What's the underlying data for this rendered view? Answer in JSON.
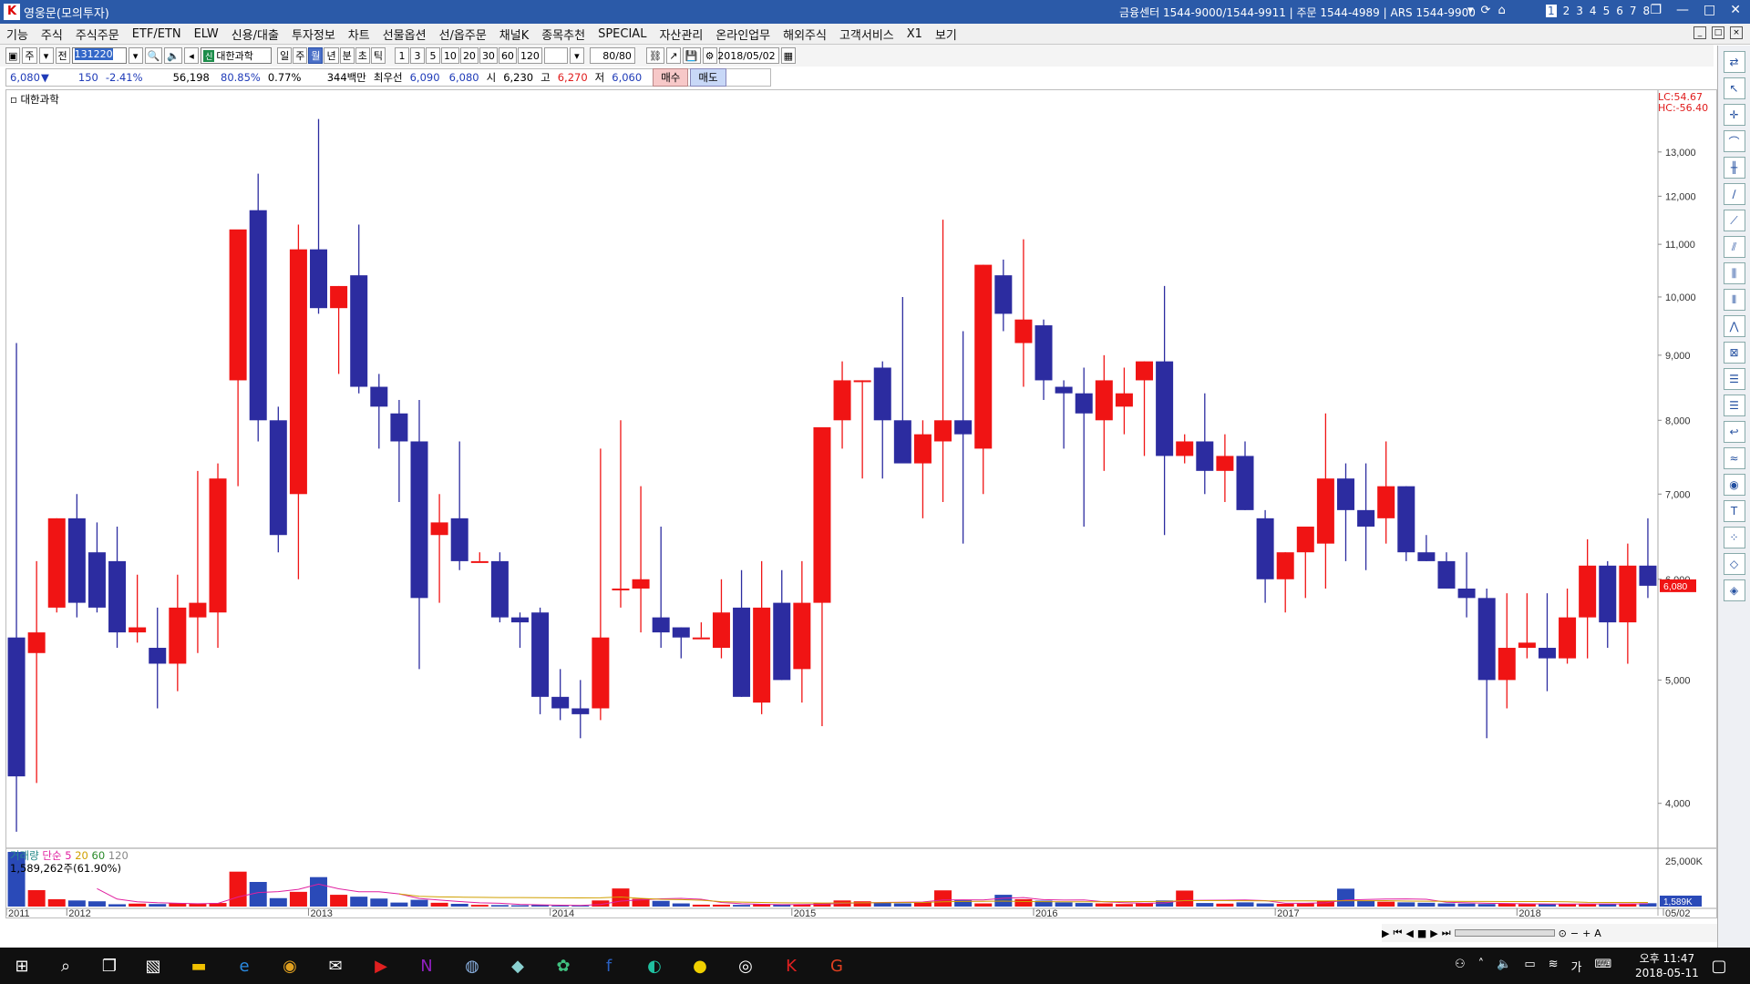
{
  "window": {
    "title": "영웅문(모의투자)",
    "center_info": "금융센터 1544-9000/1544-9911 | 주문 1544-4989 | ARS 1544-9900",
    "screens": [
      "1",
      "2",
      "3",
      "4",
      "5",
      "6",
      "7",
      "8"
    ]
  },
  "menu": [
    "기능",
    "주식",
    "주식주문",
    "ETF/ETN",
    "ELW",
    "신용/대출",
    "투자정보",
    "차트",
    "선물옵션",
    "선/옵주문",
    "채널K",
    "종목추천",
    "SPECIAL",
    "자산관리",
    "온라인업무",
    "해외주식",
    "고객서비스",
    "X1",
    "보기"
  ],
  "toolbar": {
    "buttons_left": [
      "주",
      "전"
    ],
    "code": "131220",
    "stock_badge": "신",
    "stock_name": "대한과학",
    "periods": [
      "일",
      "주",
      "월",
      "년",
      "분",
      "초",
      "틱"
    ],
    "selected_period": "월",
    "intervals": [
      "1",
      "3",
      "5",
      "10",
      "20",
      "30",
      "60",
      "120"
    ],
    "count": "80/80",
    "date": "2018/05/02"
  },
  "quote": {
    "price": "6,080",
    "change_symbol": "▼",
    "change": "150",
    "change_pct": "-2.41%",
    "volume": "56,198",
    "vol_ratio": "80.85%",
    "turnover": "0.77%",
    "amount": "344백만",
    "best_label": "최우선",
    "bid": "6,090",
    "ask": "6,080",
    "open_label": "시",
    "open": "6,230",
    "high_label": "고",
    "high": "6,270",
    "low_label": "저",
    "low": "6,060",
    "buy_label": "매수",
    "sell_label": "매도"
  },
  "chart": {
    "label": "대한과학",
    "lc": "LC:54.67",
    "hc": "HC:-56.40",
    "current_price_label": "6,080",
    "volume_label": "거래량",
    "ma_labels": [
      "단순",
      "5",
      "20",
      "60",
      "120"
    ],
    "ma_colors": [
      "#e020a0",
      "#d0a000",
      "#d08020",
      "#2a8a2a",
      "#888888"
    ],
    "volume_sub": "1,589,262주(61.90%)",
    "volume_current_label": "1,589K",
    "volume_axis_label": "25,000K",
    "x_labels": [
      "2011",
      "2012",
      "2013",
      "2014",
      "2015",
      "2016",
      "2017",
      "2018",
      "05/02"
    ],
    "y_labels": [
      "13,000",
      "12,000",
      "11,000",
      "10,000",
      "9,000",
      "8,000",
      "7,000",
      "6,000",
      "5,000",
      "4,000"
    ],
    "up_color": "#f01414",
    "down_color": "#2c2ca0"
  },
  "chart_data": {
    "type": "candlestick",
    "title": "대한과학",
    "period": "monthly",
    "y_scale": "log",
    "ylim": [
      3700,
      14300
    ],
    "candles": [
      [
        5400,
        9200,
        3800,
        4200
      ],
      [
        5250,
        6200,
        4150,
        5450
      ],
      [
        5700,
        6700,
        5650,
        6700
      ],
      [
        6700,
        7000,
        5600,
        5750
      ],
      [
        6300,
        6650,
        5650,
        5700
      ],
      [
        6200,
        6600,
        5300,
        5450
      ],
      [
        5450,
        6050,
        5350,
        5500
      ],
      [
        5300,
        5700,
        4750,
        5150
      ],
      [
        5150,
        6050,
        4900,
        5700
      ],
      [
        5600,
        7300,
        5250,
        5750
      ],
      [
        5650,
        7400,
        5300,
        7200
      ],
      [
        8600,
        9500,
        7100,
        11300
      ],
      [
        11700,
        12500,
        7700,
        8000
      ],
      [
        8000,
        8200,
        6300,
        6500
      ],
      [
        7000,
        11400,
        6000,
        10900
      ],
      [
        10900,
        13800,
        9700,
        9800
      ],
      [
        9800,
        10200,
        8700,
        10200
      ],
      [
        10400,
        11400,
        8400,
        8500
      ],
      [
        8500,
        8700,
        7600,
        8200
      ],
      [
        8100,
        8300,
        6900,
        7700
      ],
      [
        7700,
        8300,
        5100,
        5800
      ],
      [
        6500,
        7000,
        5750,
        6650
      ],
      [
        6700,
        7700,
        6100,
        6200
      ],
      [
        6200,
        6300,
        6200,
        6200
      ],
      [
        6200,
        6300,
        5550,
        5600
      ],
      [
        5600,
        5650,
        5300,
        5550
      ],
      [
        5650,
        5700,
        4700,
        4850
      ],
      [
        4850,
        5100,
        4650,
        4750
      ],
      [
        4750,
        5000,
        4500,
        4700
      ],
      [
        4750,
        7600,
        4650,
        5400
      ],
      [
        5900,
        8000,
        5700,
        5900
      ],
      [
        5900,
        7100,
        5450,
        6000
      ],
      [
        5600,
        6600,
        5300,
        5450
      ],
      [
        5500,
        5500,
        5200,
        5400
      ],
      [
        5400,
        5550,
        5400,
        5400
      ],
      [
        5300,
        6000,
        5200,
        5650
      ],
      [
        5700,
        6100,
        4850,
        4850
      ],
      [
        4800,
        6200,
        4700,
        5700
      ],
      [
        5750,
        6100,
        5000,
        5000
      ],
      [
        5100,
        6200,
        4800,
        5750
      ],
      [
        5750,
        6700,
        4600,
        7900
      ],
      [
        8000,
        8900,
        7600,
        8600
      ],
      [
        8600,
        8600,
        7200,
        8600
      ],
      [
        8800,
        8900,
        7200,
        8000
      ],
      [
        8000,
        10000,
        7700,
        7400
      ],
      [
        7400,
        8000,
        6700,
        7800
      ],
      [
        7700,
        11500,
        6900,
        8000
      ],
      [
        8000,
        9400,
        6400,
        7800
      ],
      [
        7600,
        10600,
        7000,
        10600
      ],
      [
        10400,
        10700,
        9400,
        9700
      ],
      [
        9200,
        11100,
        8500,
        9600
      ],
      [
        9500,
        9600,
        8300,
        8600
      ],
      [
        8500,
        8600,
        7600,
        8400
      ],
      [
        8400,
        8800,
        6600,
        8100
      ],
      [
        8000,
        9000,
        7300,
        8600
      ],
      [
        8200,
        8800,
        7800,
        8400
      ],
      [
        8600,
        8900,
        7500,
        8900
      ],
      [
        8900,
        10200,
        6500,
        7500
      ],
      [
        7500,
        7800,
        7400,
        7700
      ],
      [
        7700,
        8400,
        7000,
        7300
      ],
      [
        7300,
        7800,
        6900,
        7500
      ],
      [
        7500,
        7700,
        6800,
        6800
      ],
      [
        6700,
        6800,
        5750,
        6000
      ],
      [
        6000,
        6300,
        5650,
        6300
      ],
      [
        6300,
        6500,
        5800,
        6600
      ],
      [
        6400,
        8100,
        5900,
        7200
      ],
      [
        7200,
        7400,
        6200,
        6800
      ],
      [
        6800,
        7400,
        6100,
        6600
      ],
      [
        6700,
        7700,
        6400,
        7100
      ],
      [
        7100,
        7100,
        6200,
        6300
      ],
      [
        6300,
        6500,
        6200,
        6200
      ],
      [
        6200,
        6300,
        5900,
        5900
      ],
      [
        5900,
        6300,
        5600,
        5800
      ],
      [
        5800,
        5900,
        4500,
        5000
      ],
      [
        5000,
        5850,
        4750,
        5300
      ],
      [
        5300,
        5850,
        5200,
        5350
      ],
      [
        5300,
        5850,
        4900,
        5200
      ],
      [
        5200,
        5900,
        5150,
        5600
      ],
      [
        5600,
        6450,
        5200,
        6150
      ],
      [
        6150,
        6200,
        5300,
        5550
      ],
      [
        5550,
        6400,
        5150,
        6150
      ],
      [
        6150,
        6700,
        5800,
        5930
      ]
    ],
    "volume_k": [
      26000,
      7800,
      3500,
      2900,
      2500,
      1100,
      1400,
      1200,
      1700,
      1500,
      1700,
      16600,
      11700,
      4000,
      7000,
      14000,
      5600,
      4700,
      3800,
      1900,
      3200,
      1800,
      1300,
      800,
      700,
      600,
      700,
      400,
      400,
      2900,
      8600,
      3700,
      2700,
      1500,
      900,
      900,
      800,
      1200,
      900,
      1000,
      1500,
      2900,
      2500,
      1800,
      1500,
      2100,
      7700,
      3000,
      1500,
      5600,
      3500,
      2800,
      2000,
      1700,
      1500,
      1200,
      1500,
      2900,
      7600,
      1700,
      1400,
      2000,
      1500,
      1300,
      1600,
      2600,
      8500,
      2800,
      2300,
      2000,
      1800,
      1500,
      1400,
      1200,
      1300,
      1200,
      1200,
      1100,
      1300,
      1300,
      1400,
      1589
    ]
  }
}
